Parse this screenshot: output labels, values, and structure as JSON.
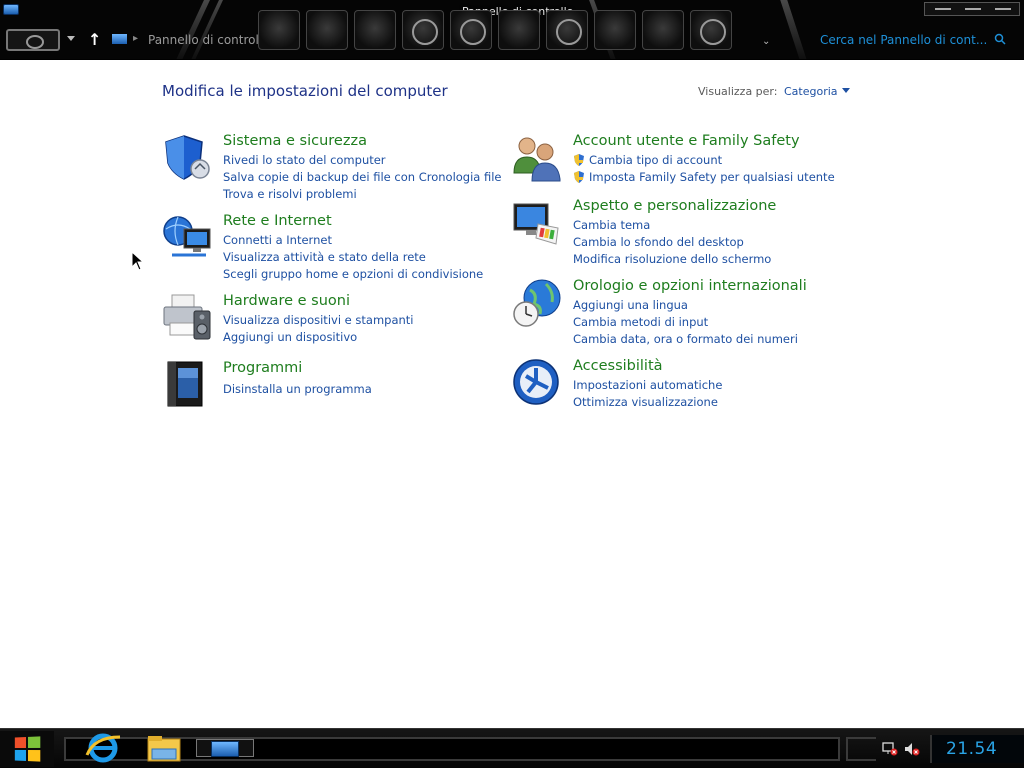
{
  "window": {
    "title": "Pannello di controllo",
    "breadcrumb": "Pannello di controllo",
    "search_placeholder": "Cerca nel Pannello di cont..."
  },
  "header": {
    "heading": "Modifica le impostazioni del computer",
    "view_by_label": "Visualizza per:",
    "view_by_value": "Categoria"
  },
  "categories": [
    {
      "title": "Sistema e sicurezza",
      "icon": "shield-icon",
      "links": [
        {
          "text": "Rivedi lo stato del computer",
          "shield": false
        },
        {
          "text": "Salva copie di backup dei file con Cronologia file",
          "shield": false
        },
        {
          "text": "Trova e risolvi problemi",
          "shield": false
        }
      ]
    },
    {
      "title": "Rete e Internet",
      "icon": "globe-network-icon",
      "links": [
        {
          "text": "Connetti a Internet",
          "shield": false
        },
        {
          "text": "Visualizza attività e stato della rete",
          "shield": false
        },
        {
          "text": "Scegli gruppo home e opzioni di condivisione",
          "shield": false
        }
      ]
    },
    {
      "title": "Hardware e suoni",
      "icon": "printer-speaker-icon",
      "links": [
        {
          "text": "Visualizza dispositivi e stampanti",
          "shield": false
        },
        {
          "text": "Aggiungi un dispositivo",
          "shield": false
        }
      ]
    },
    {
      "title": "Programmi",
      "icon": "programs-icon",
      "links": [
        {
          "text": "Disinstalla un programma",
          "shield": false
        }
      ]
    },
    {
      "title": "Account utente e Family Safety",
      "icon": "users-icon",
      "links": [
        {
          "text": "Cambia tipo di account",
          "shield": true
        },
        {
          "text": "Imposta Family Safety per qualsiasi utente",
          "shield": true
        }
      ]
    },
    {
      "title": "Aspetto e personalizzazione",
      "icon": "monitor-palette-icon",
      "links": [
        {
          "text": "Cambia tema",
          "shield": false
        },
        {
          "text": "Cambia lo sfondo del desktop",
          "shield": false
        },
        {
          "text": "Modifica risoluzione dello schermo",
          "shield": false
        }
      ]
    },
    {
      "title": "Orologio e opzioni internazionali",
      "icon": "clock-globe-icon",
      "links": [
        {
          "text": "Aggiungi una lingua",
          "shield": false
        },
        {
          "text": "Cambia metodi di input",
          "shield": false
        },
        {
          "text": "Cambia data, ora o formato dei numeri",
          "shield": false
        }
      ]
    },
    {
      "title": "Accessibilità",
      "icon": "accessibility-icon",
      "links": [
        {
          "text": "Impostazioni automatiche",
          "shield": false
        },
        {
          "text": "Ottimizza visualizzazione",
          "shield": false
        }
      ]
    }
  ],
  "taskbar": {
    "pinned": [
      "internet-explorer-icon",
      "file-explorer-icon"
    ],
    "clock": "21.54",
    "tray": [
      "network-disconnected-icon",
      "volume-muted-icon"
    ]
  },
  "colors": {
    "category_title": "#1e7d1e",
    "link": "#1e50a2",
    "heading": "#1e3287",
    "clock": "#2aa4e6",
    "search_text": "#1e90d8"
  }
}
